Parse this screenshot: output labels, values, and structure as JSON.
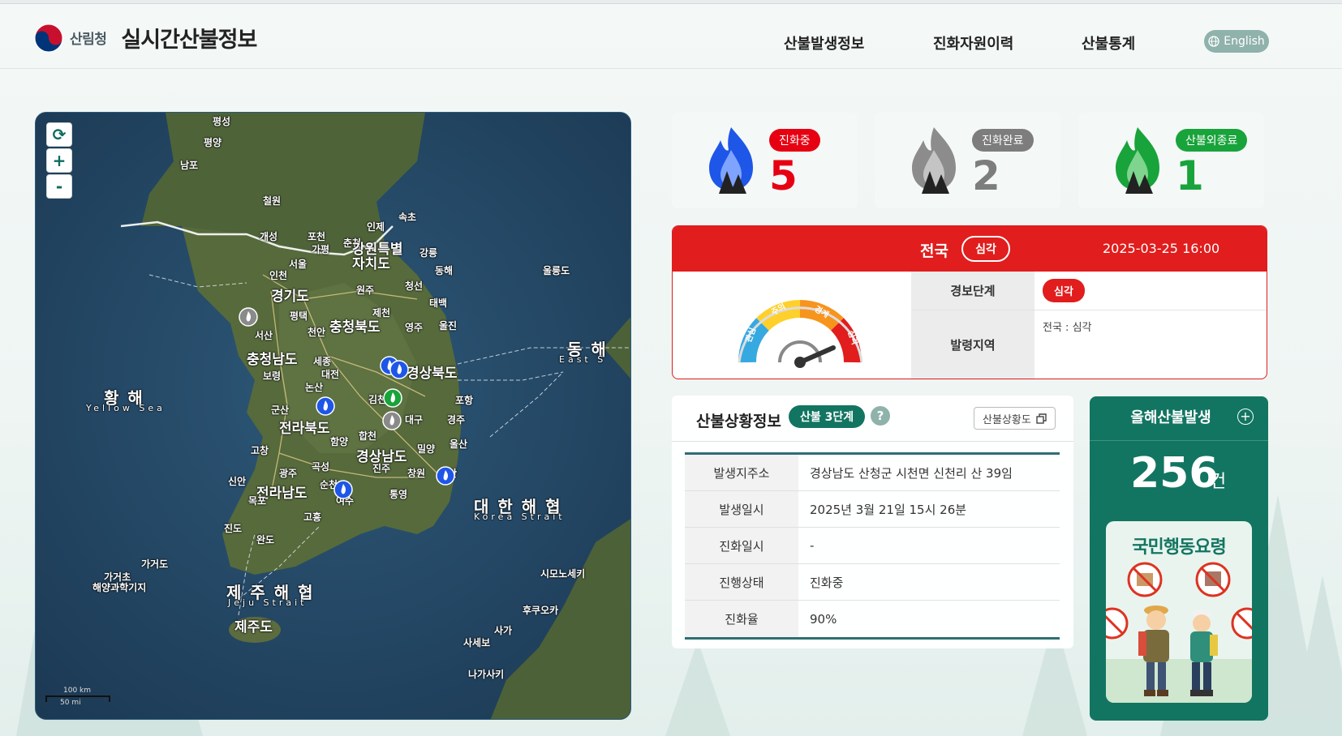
{
  "header": {
    "org_name": "산림청",
    "site_title": "실시간산불정보",
    "nav": [
      "산불발생정보",
      "진화자원이력",
      "산불통계"
    ],
    "lang_label": "English"
  },
  "map": {
    "controls": {
      "refresh": "⟳",
      "zoom_in": "+",
      "zoom_out": "-"
    },
    "labels": {
      "pyeongseong": "평성",
      "pyeongyang": "평양",
      "nampo": "남포",
      "cheorwon": "철원",
      "sokcho": "속초",
      "inje": "인제",
      "gaeseong": "개성",
      "pocheon": "포천",
      "gapyeong": "가평",
      "chuncheon": "춘천",
      "seoul": "서울",
      "incheon": "인천",
      "gangwon": "강원특별자치도",
      "gangneung": "강릉",
      "donghae": "동해",
      "gyeonggi": "경기도",
      "wonju": "원주",
      "jeongseon": "청선",
      "taebaek": "태백",
      "pyeongtaek": "평택",
      "jecheon": "제천",
      "cheonan": "천안",
      "chungbuk": "충청북도",
      "yeongju": "영주",
      "uljin": "울진",
      "seosan": "서산",
      "chungnam": "충청남도",
      "sejong": "세종",
      "daejeon": "대전",
      "boryeong": "보령",
      "gyeongbuk": "경상북도",
      "nonsan": "논산",
      "gimcheon": "김천",
      "pohang": "포항",
      "gunsan": "군산",
      "daegu": "대구",
      "gyeongju": "경주",
      "jeonbuk": "전라북도",
      "hapcheon": "합천",
      "gochang": "고창",
      "hamyang": "함양",
      "miryang": "밀양",
      "ulsan": "울산",
      "gyeongnam": "경상남도",
      "gokseong": "곡성",
      "jinju": "진주",
      "changwon": "창원",
      "busan": "부산",
      "gwangju": "광주",
      "sinan": "신안",
      "jeonnam": "전라남도",
      "suncheon": "순천",
      "tongyeong": "통영",
      "mokpo": "목포",
      "yeosu": "여수",
      "goheung": "고흥",
      "jindo": "진도",
      "wando": "완도",
      "gageodo": "가거도",
      "gageocho": "가거초",
      "gageocho2": "해양과학기지",
      "jeju": "제주도",
      "ulleungdo": "울릉도",
      "shimonoseki": "시모노세키",
      "fukuoka": "후쿠오카",
      "saga": "사가",
      "sasebo": "사세보",
      "nagasaki": "나가사키",
      "yellow_sea": "황 해",
      "yellow_sea_en": "Yellow Sea",
      "east_sea": "동 해",
      "east_sea_en": "East S",
      "korea_strait": "대 한 해 협",
      "korea_strait_en": "Korea Strait",
      "jeju_strait": "제 주 해 협",
      "jeju_strait_en": "Jeju Strait"
    },
    "scale_km": "100 km",
    "scale_mi": "50 mi"
  },
  "status": {
    "burning": {
      "label": "진화중",
      "count": "5",
      "color": "#e60012"
    },
    "done": {
      "label": "진화완료",
      "count": "2",
      "color": "#7d7d7d"
    },
    "ended": {
      "label": "산불외종료",
      "count": "1",
      "color": "#19a33b"
    }
  },
  "alert": {
    "region": "전국",
    "level": "심각",
    "datetime": "2025-03-25 16:00",
    "gauge_labels": [
      "관심",
      "주의",
      "경계",
      "심각"
    ],
    "rows": [
      {
        "key": "경보단계",
        "value": "심각"
      },
      {
        "key": "발령지역",
        "value": "전국 : 심각"
      }
    ]
  },
  "fire_info": {
    "title": "산불상황정보",
    "stage": "산불 3단계",
    "help": "?",
    "map_button": "산불상황도",
    "rows": [
      {
        "key": "발생지주소",
        "value": "경상남도 산청군 시천면 신천리 산 39임"
      },
      {
        "key": "발생일시",
        "value": "2025년 3월 21일 15시 26분"
      },
      {
        "key": "진화일시",
        "value": "-"
      },
      {
        "key": "진행상태",
        "value": "진화중"
      },
      {
        "key": "진화율",
        "value": "90%"
      }
    ]
  },
  "yearly": {
    "title": "올해산불발생",
    "count": "256",
    "unit": "건",
    "action_title": "국민행동요령"
  },
  "colors": {
    "brand_green": "#127561",
    "alert_red": "#e11d1d",
    "burning_blue": "#1e56e8"
  }
}
